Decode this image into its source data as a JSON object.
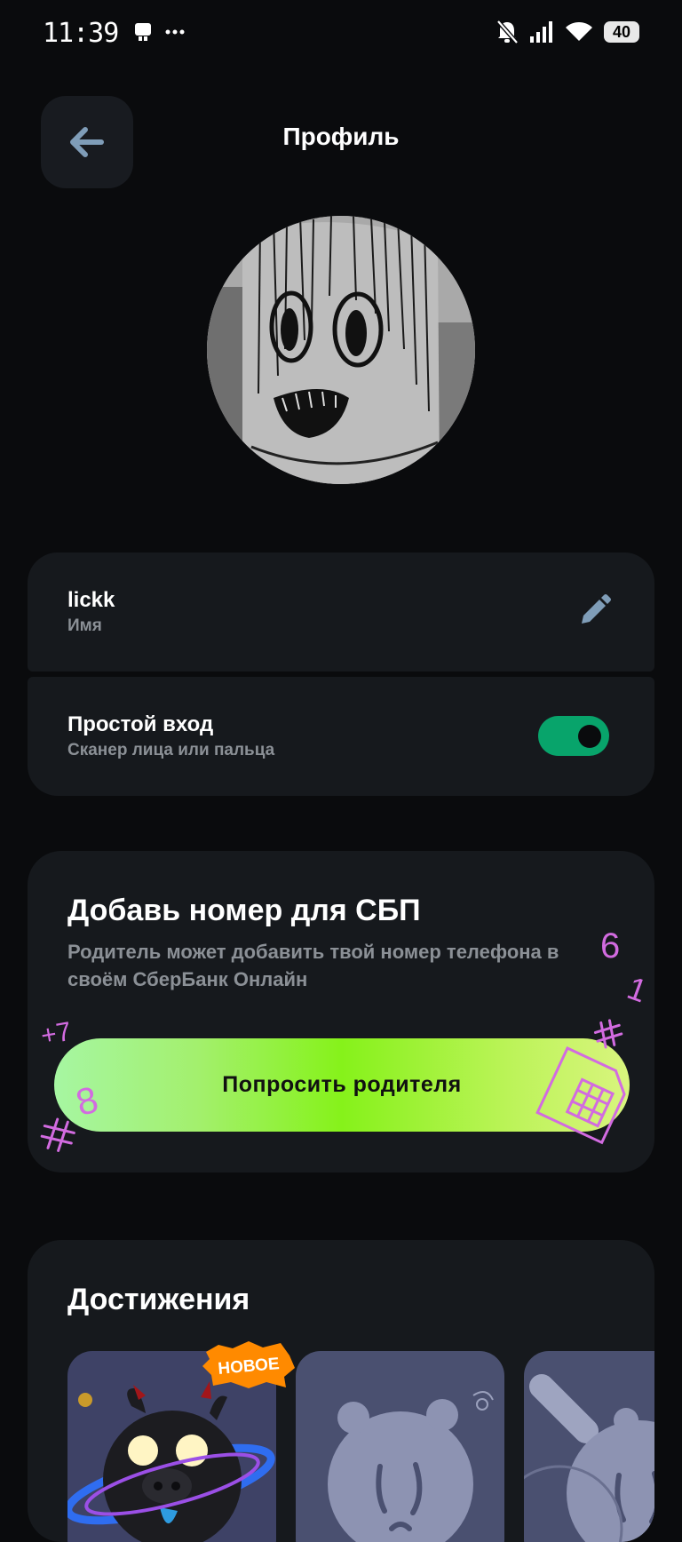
{
  "status_bar": {
    "time": "11:39",
    "left_icons": [
      "notification-icon",
      "more-dots-icon"
    ],
    "right_icons": [
      "bell-off-icon",
      "signal-icon",
      "wifi-icon"
    ],
    "battery": "40"
  },
  "header": {
    "title": "Профиль",
    "back_icon": "arrow-left-icon"
  },
  "profile": {
    "name_value": "lickk",
    "name_label": "Имя",
    "edit_icon": "pencil-icon"
  },
  "simple_login": {
    "title": "Простой вход",
    "subtitle": "Сканер лица или пальца",
    "enabled": true
  },
  "sbp_card": {
    "title": "Добавь номер для СБП",
    "description": "Родитель может добавить твой номер телефона в своём СберБанк Онлайн",
    "button_label": "Попросить родителя",
    "doodle_digits": [
      "6",
      "1",
      "8",
      "+7"
    ]
  },
  "achievements": {
    "title": "Достижения",
    "badge_new": "НОВОЕ",
    "tiles": [
      "black-pig-achievement",
      "locked-achievement",
      "locked-achievement"
    ]
  },
  "colors": {
    "background": "#0a0b0d",
    "card": "#16191d",
    "toggle_on": "#08a46b",
    "doodle": "#d26be0",
    "badge": "#ff8a00"
  }
}
